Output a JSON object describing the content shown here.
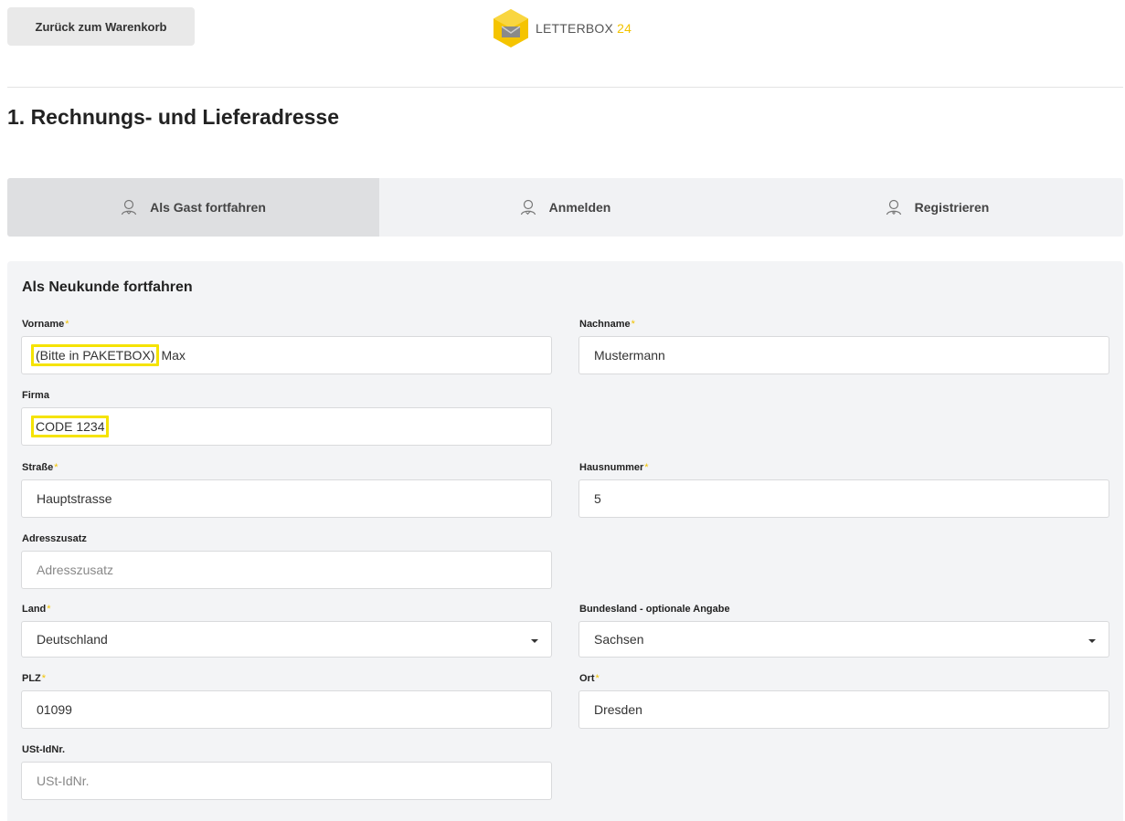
{
  "header": {
    "back_label": "Zurück zum Warenkorb",
    "logo_text": "LETTERBOX",
    "logo_number": "24"
  },
  "page_title": "1. Rechnungs- und Lieferadresse",
  "tabs": [
    {
      "label": "Als Gast fortfahren",
      "active": true
    },
    {
      "label": "Anmelden",
      "active": false
    },
    {
      "label": "Registrieren",
      "active": false
    }
  ],
  "form": {
    "title": "Als Neukunde fortfahren",
    "required_mark": "*",
    "vorname": {
      "label": "Vorname",
      "highlight": "(Bitte in PAKETBOX)",
      "value": "Max"
    },
    "nachname": {
      "label": "Nachname",
      "value": "Mustermann"
    },
    "firma": {
      "label": "Firma",
      "value": "CODE 1234"
    },
    "strasse": {
      "label": "Straße",
      "value": "Hauptstrasse"
    },
    "hausnummer": {
      "label": "Hausnummer",
      "value": "5"
    },
    "adresszusatz": {
      "label": "Adresszusatz",
      "placeholder": "Adresszusatz"
    },
    "land": {
      "label": "Land",
      "value": "Deutschland"
    },
    "bundesland": {
      "label": "Bundesland - optionale Angabe",
      "value": "Sachsen"
    },
    "plz": {
      "label": "PLZ",
      "value": "01099"
    },
    "ort": {
      "label": "Ort",
      "value": "Dresden"
    },
    "ustid": {
      "label": "USt-IdNr.",
      "placeholder": "USt-IdNr."
    }
  },
  "colors": {
    "accent": "#f2c300",
    "highlight_box": "#f5e300",
    "panel_bg": "#f3f4f6",
    "tab_active_bg": "#dedfe1"
  }
}
